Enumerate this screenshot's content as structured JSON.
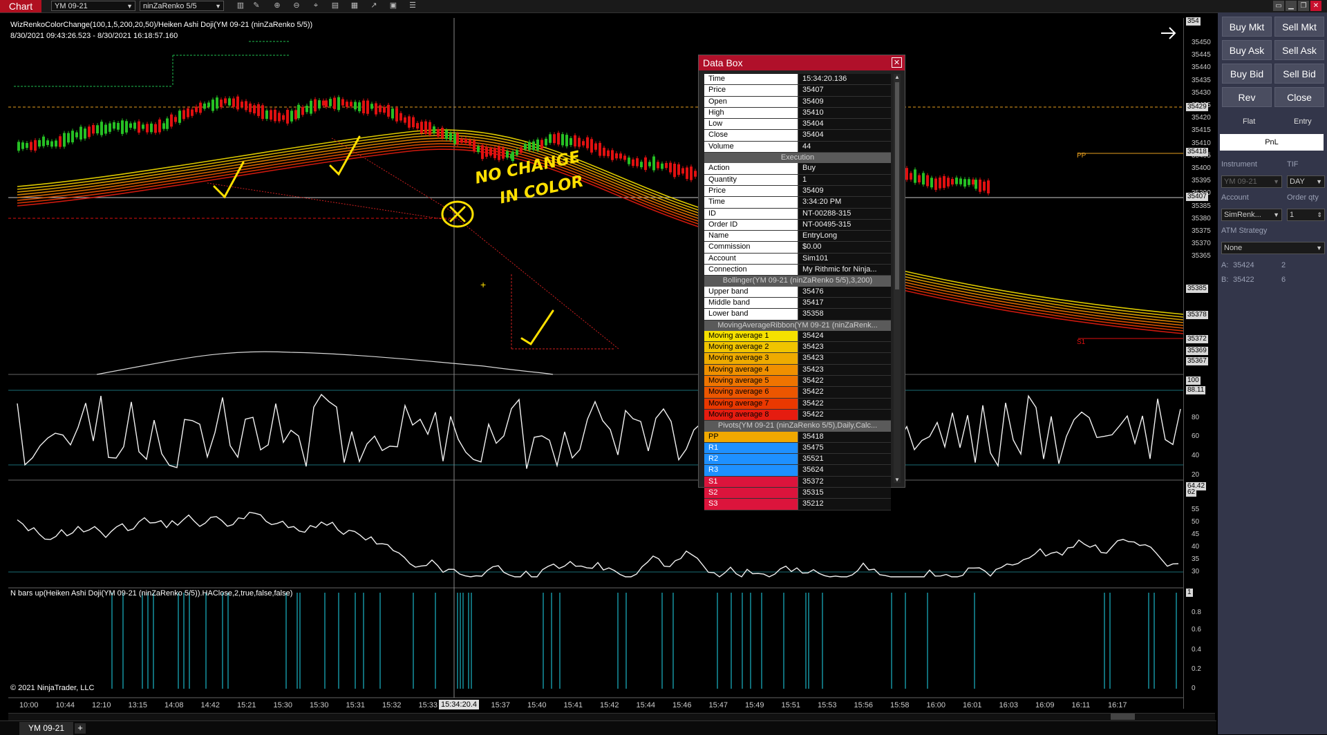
{
  "titlebar": {
    "chart_tab": "Chart",
    "instrument_dropdown": "YM 09-21",
    "bartype_dropdown": "ninZaRenko 5/5",
    "toolbar_icons": [
      "bars-icon",
      "draw-icon",
      "zoom-in-icon",
      "zoom-out-icon",
      "crosshair-icon",
      "properties-icon",
      "indicators-icon",
      "strategies-icon",
      "templates-icon",
      "list-icon"
    ]
  },
  "chart": {
    "header_line1": "WizRenkoColorChange(100,1,5,200,20,50)/Heiken Ashi Doji(YM 09-21 (ninZaRenko 5/5))",
    "header_line2": "8/30/2021 09:43:26.523 - 8/30/2021 16:18:57.160",
    "price_labels": [
      "35450",
      "35445",
      "35440",
      "35435",
      "35430",
      "35425",
      "35420",
      "35415",
      "35410",
      "35405",
      "35400",
      "35395",
      "35390",
      "35385",
      "35380",
      "35375",
      "35370",
      "35365"
    ],
    "price_markers": [
      "35429",
      "35418",
      "35407",
      "35385",
      "35378",
      "35372",
      "35369",
      "35367",
      "100"
    ],
    "top_marker": "354",
    "osc1_labels": [
      "88.11",
      "80",
      "60",
      "40",
      "20",
      "0"
    ],
    "osc2_labels": [
      "64.42",
      "62",
      "55",
      "50",
      "45",
      "40",
      "35",
      "30"
    ],
    "nbars_labels": [
      "1",
      "0.8",
      "0.6",
      "0.4",
      "0.2",
      "0"
    ],
    "nbars_header": "N bars up(Heiken Ashi Doji(YM 09-21 (ninZaRenko 5/5)).HAClose,2,true,false,false)",
    "copyright": "© 2021 NinjaTrader, LLC",
    "pp_label": "PP",
    "s1_label": "S1",
    "time_labels": [
      "10:00",
      "10:44",
      "12:10",
      "13:15",
      "14:08",
      "14:42",
      "15:21",
      "15:30",
      "15:30",
      "15:31",
      "15:32",
      "15:33",
      "15:35",
      "15:37",
      "15:40",
      "15:41",
      "15:42",
      "15:44",
      "15:46",
      "15:47",
      "15:49",
      "15:51",
      "15:53",
      "15:56",
      "15:58",
      "16:00",
      "16:01",
      "16:03",
      "16:09",
      "16:11",
      "16:17"
    ],
    "cursor_time": "15:34:20.4",
    "annotation_text1": "NO CHANGE",
    "annotation_text2": "IN COLOR"
  },
  "databox": {
    "title": "Data Box",
    "bar_rows": [
      {
        "label": "Time",
        "value": "15:34:20.136"
      },
      {
        "label": "Price",
        "value": "35407"
      },
      {
        "label": "Open",
        "value": "35409"
      },
      {
        "label": "High",
        "value": "35410"
      },
      {
        "label": "Low",
        "value": "35404"
      },
      {
        "label": "Close",
        "value": "35404"
      },
      {
        "label": "Volume",
        "value": "44"
      }
    ],
    "execution_header": "Execution",
    "execution_rows": [
      {
        "label": "Action",
        "value": "Buy"
      },
      {
        "label": "Quantity",
        "value": "1"
      },
      {
        "label": "Price",
        "value": "35409"
      },
      {
        "label": "Time",
        "value": "3:34:20 PM"
      },
      {
        "label": "ID",
        "value": "NT-00288-315"
      },
      {
        "label": "Order ID",
        "value": "NT-00495-315"
      },
      {
        "label": "Name",
        "value": "EntryLong"
      },
      {
        "label": "Commission",
        "value": "$0.00"
      },
      {
        "label": "Account",
        "value": "Sim101"
      },
      {
        "label": "Connection",
        "value": "My Rithmic for Ninja..."
      }
    ],
    "bollinger_header": "Bollinger(YM 09-21 (ninZaRenko 5/5),3,200)",
    "bollinger_rows": [
      {
        "label": "Upper band",
        "value": "35476"
      },
      {
        "label": "Middle band",
        "value": "35417"
      },
      {
        "label": "Lower band",
        "value": "35358"
      }
    ],
    "ribbon_header": "MovingAverageRibbon(YM 09-21 (ninZaRenk...",
    "ribbon_rows": [
      {
        "label": "Moving average 1",
        "value": "35424",
        "color": "#f5e000"
      },
      {
        "label": "Moving average 2",
        "value": "35423",
        "color": "#f0c400"
      },
      {
        "label": "Moving average 3",
        "value": "35423",
        "color": "#eeab00"
      },
      {
        "label": "Moving average 4",
        "value": "35423",
        "color": "#f09000"
      },
      {
        "label": "Moving average 5",
        "value": "35422",
        "color": "#ef7400"
      },
      {
        "label": "Moving average 6",
        "value": "35422",
        "color": "#ec5600"
      },
      {
        "label": "Moving average 7",
        "value": "35422",
        "color": "#ea3800"
      },
      {
        "label": "Moving average 8",
        "value": "35422",
        "color": "#e51c10"
      }
    ],
    "pivots_header": "Pivots(YM 09-21 (ninZaRenko 5/5),Daily,Calc...",
    "pivot_rows": [
      {
        "label": "PP",
        "value": "35418",
        "color": "#f0a800"
      },
      {
        "label": "R1",
        "value": "35475",
        "color": "#1e90ff"
      },
      {
        "label": "R2",
        "value": "35521",
        "color": "#1e90ff"
      },
      {
        "label": "R3",
        "value": "35624",
        "color": "#1e90ff"
      },
      {
        "label": "S1",
        "value": "35372",
        "color": "#dc143c"
      },
      {
        "label": "S2",
        "value": "35315",
        "color": "#dc143c"
      },
      {
        "label": "S3",
        "value": "35212",
        "color": "#dc143c"
      }
    ]
  },
  "chart_trader": {
    "buy_mkt": "Buy Mkt",
    "sell_mkt": "Sell Mkt",
    "buy_ask": "Buy Ask",
    "sell_ask": "Sell Ask",
    "buy_bid": "Buy Bid",
    "sell_bid": "Sell Bid",
    "rev": "Rev",
    "close": "Close",
    "flat": "Flat",
    "entry": "Entry",
    "pnl": "PnL",
    "instrument_label": "Instrument",
    "tif_label": "TIF",
    "instrument_value": "YM 09-21",
    "tif_value": "DAY",
    "account_label": "Account",
    "order_qty_label": "Order qty",
    "account_value": "SimRenk...",
    "qty_value": "1",
    "atm_label": "ATM Strategy",
    "atm_value": "None",
    "ask_label": "A:",
    "ask_price": "35424",
    "ask_size": "2",
    "bid_label": "B:",
    "bid_price": "35422",
    "bid_size": "6"
  },
  "bottom_tabs": {
    "active_tab": "YM 09-21",
    "add_tab": "+"
  }
}
